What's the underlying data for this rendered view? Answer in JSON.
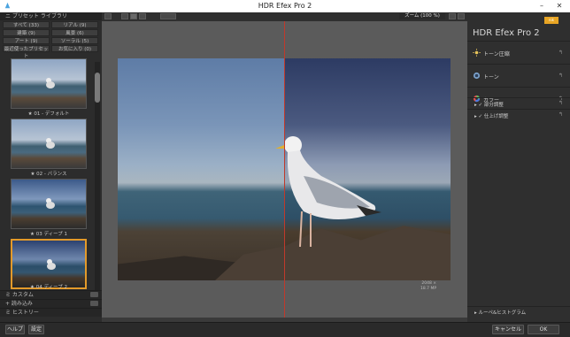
{
  "window": {
    "title": "HDR Efex Pro 2",
    "min": "–",
    "close": "✕"
  },
  "left": {
    "header": "ニ プリセット ライブラリ",
    "tabs": [
      {
        "label": "すべて (33)"
      },
      {
        "label": "リアル (9)"
      },
      {
        "label": "建築 (9)"
      },
      {
        "label": "風景 (6)"
      },
      {
        "label": "アート (9)"
      },
      {
        "label": "ソーラル (5)"
      },
      {
        "label": "最近使ったプリセット"
      },
      {
        "label": "お気に入り (0)"
      }
    ],
    "thumbs": [
      {
        "label": "★ 01 - デフォルト"
      },
      {
        "label": "★ 02 - バランス"
      },
      {
        "label": "★ 03 ディープ 1"
      },
      {
        "label": "★ 04 ディープ 2"
      }
    ],
    "sections": [
      {
        "label": "ミ カスタム"
      },
      {
        "label": "+ 読み込み"
      },
      {
        "label": "ミ ヒストリー"
      }
    ]
  },
  "toolbar": {
    "zoom": "ズーム (100 %)"
  },
  "photo": {
    "info_line1": "2048 ×",
    "info_line2": "18.7 MP"
  },
  "right": {
    "badge": "nik",
    "title": "HDR Efex Pro 2",
    "sections": [
      {
        "label": "トーン圧縮"
      },
      {
        "label": "トーン"
      },
      {
        "label": "カラー"
      }
    ],
    "subsections": [
      {
        "label": "▸ ✓ 部分調整"
      },
      {
        "label": "▸ ✓ 仕上げ調整"
      }
    ],
    "loupe": "▸ ルーペ&ヒストグラム"
  },
  "bottom": {
    "help": "ヘルプ",
    "settings": "設定",
    "cancel": "キャンセル",
    "ok": "OK"
  },
  "colors": {
    "accent": "#e39a2a",
    "split": "#c0392b",
    "badge": "#e8a524"
  }
}
